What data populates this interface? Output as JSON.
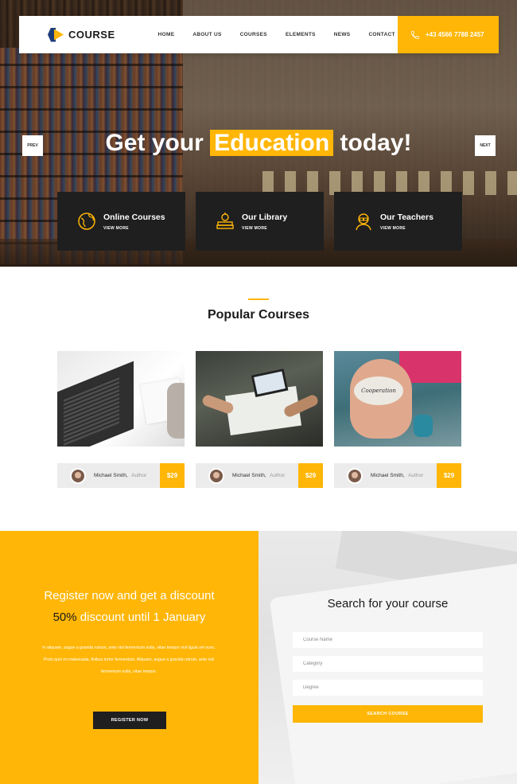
{
  "nav": {
    "logo_text": "COURSE",
    "links": [
      "HOME",
      "ABOUT US",
      "COURSES",
      "ELEMENTS",
      "NEWS",
      "CONTACT"
    ],
    "phone": "+43 4566 7788 2457"
  },
  "hero": {
    "title_before": "Get your",
    "title_highlight": "Education",
    "title_after": "today!",
    "prev_label": "PREV",
    "next_label": "NEXT",
    "boxes": [
      {
        "title": "Online Courses",
        "more": "VIEW MORE",
        "icon": "globe-icon"
      },
      {
        "title": "Our Library",
        "more": "VIEW MORE",
        "icon": "books-icon"
      },
      {
        "title": "Our Teachers",
        "more": "VIEW MORE",
        "icon": "teacher-icon"
      }
    ]
  },
  "popular": {
    "title": "Popular Courses",
    "cards": [
      {
        "author": "Michael Smith,",
        "role": "Author",
        "price": "$29"
      },
      {
        "author": "Michael Smith,",
        "role": "Author",
        "price": "$29"
      },
      {
        "author": "Michael Smith,",
        "role": "Author",
        "price": "$29",
        "stone_text": "Cooperation"
      }
    ]
  },
  "register": {
    "line1": "Register now and get a discount",
    "pct": "50%",
    "line2_rest": "discount until 1 January",
    "body": "In aliquam, augue a gravida rutrum, ante nisl fermentum nulla, vitae tempor nisl ligula vel nunc. Proin quis mi malesuada, finibus tortor fermentum. Aliquam, augue a gravida rutrum, ante nisl fermentum nulla, vitae tempor.",
    "button": "REGISTER NOW"
  },
  "search": {
    "title": "Search for your course",
    "placeholders": [
      "Course Name",
      "Category",
      "Degree"
    ],
    "button": "SEARCH COURSE"
  },
  "colors": {
    "accent": "#ffb606",
    "dark": "#1f1f1f"
  }
}
